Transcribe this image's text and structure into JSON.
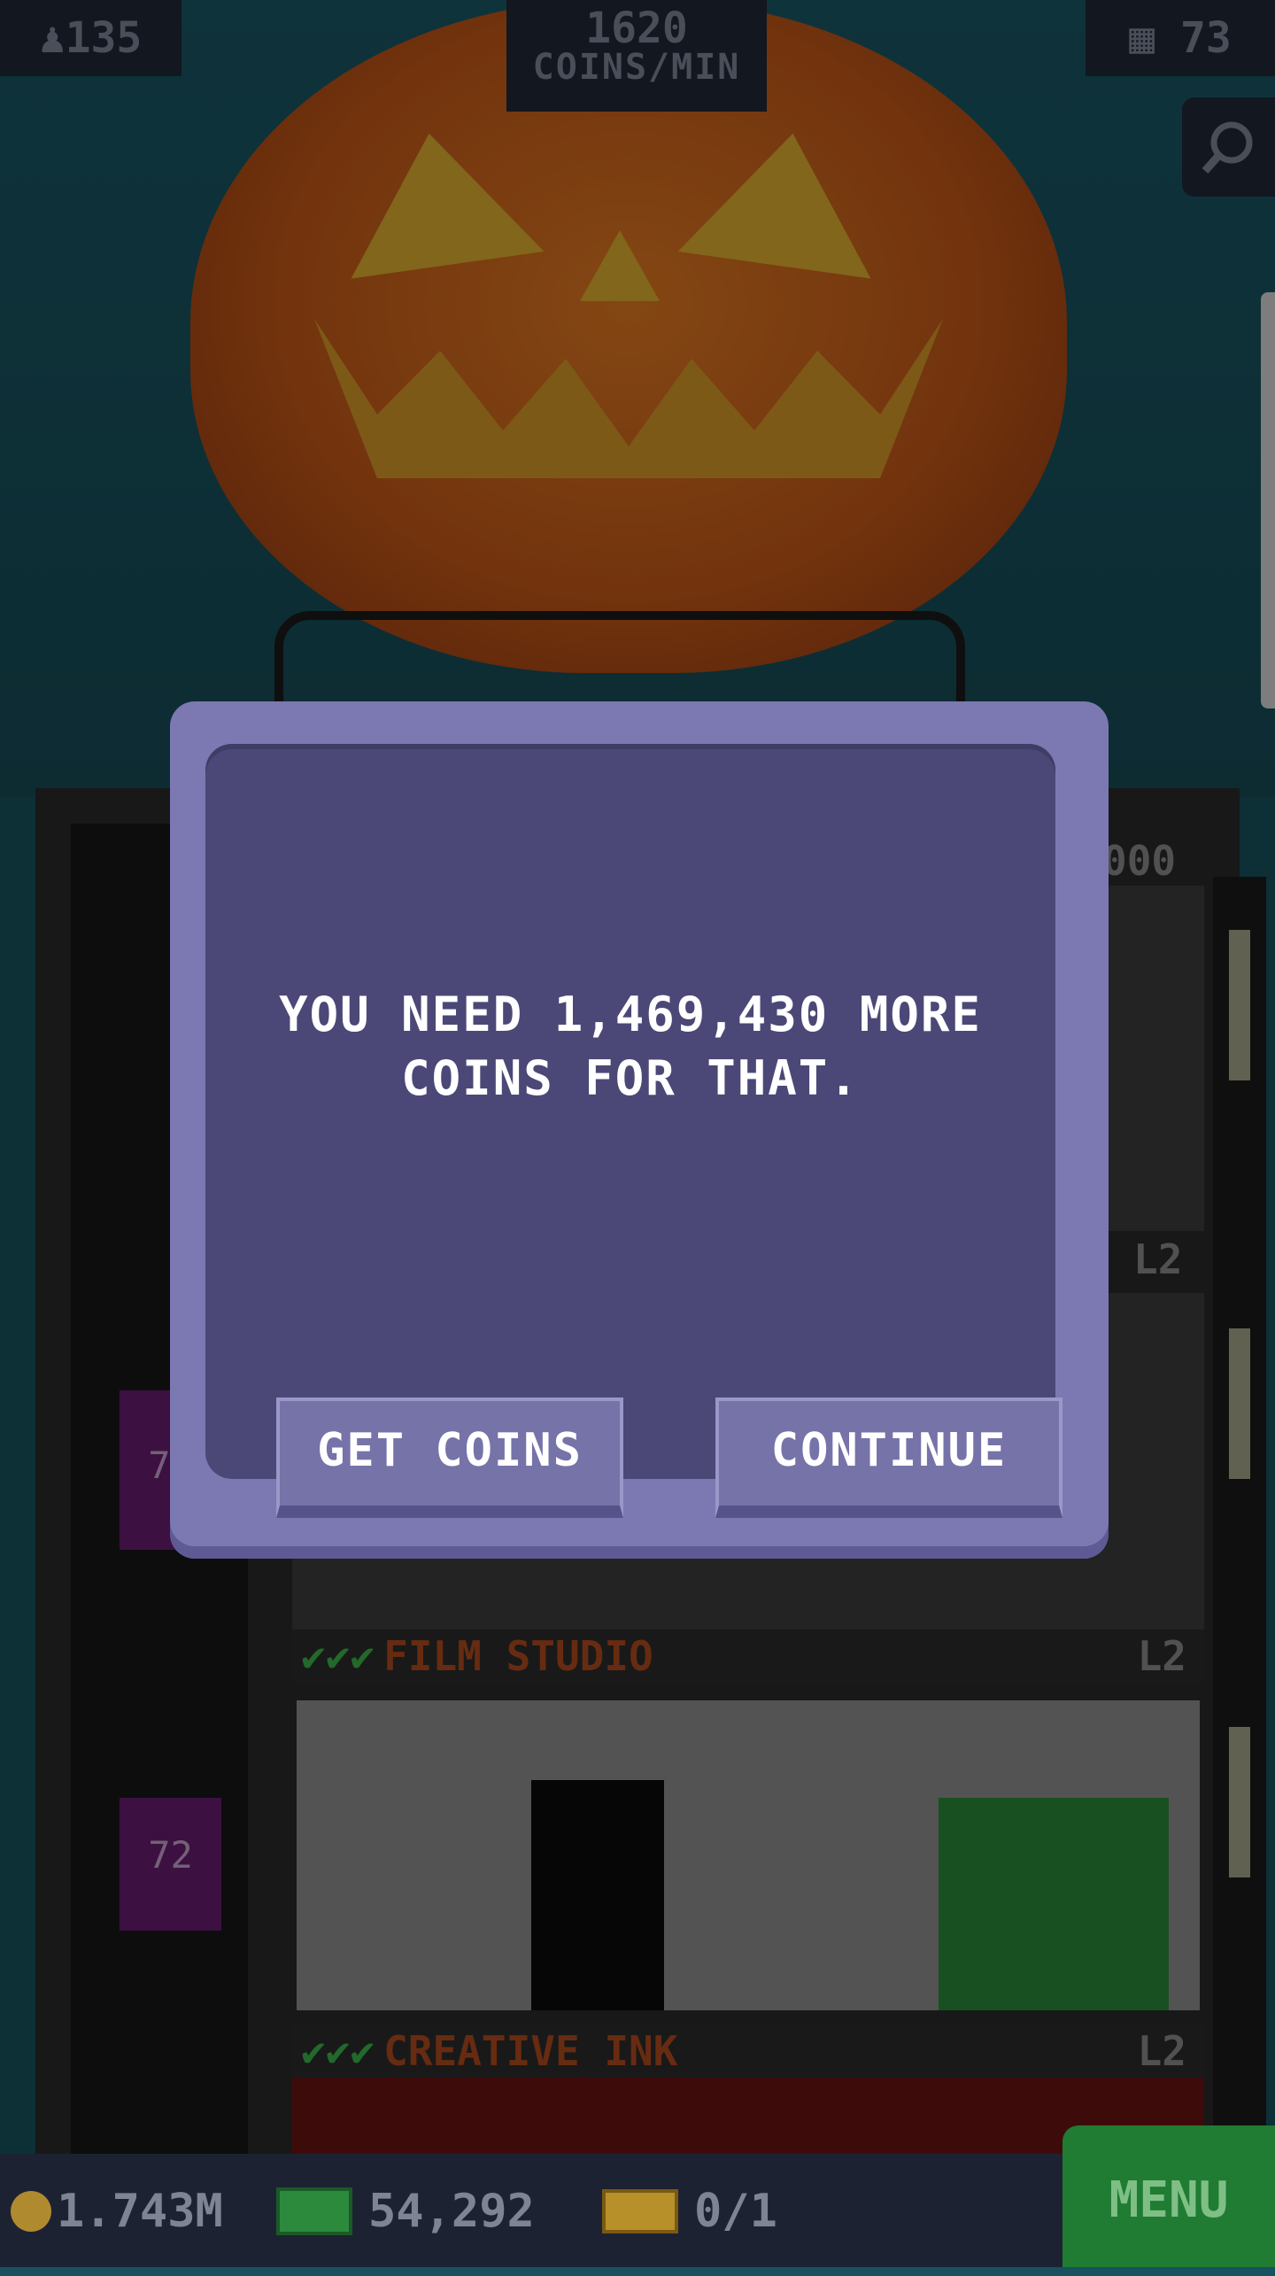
{
  "hud": {
    "population": "135",
    "coins_per_min_value": "1620",
    "coins_per_min_unit": "COINS/MIN",
    "floors": "73",
    "icons": {
      "population": "person-icon",
      "floors": "building-icon",
      "search": "magnifier-icon"
    }
  },
  "tower": {
    "elevator_labels": [
      "73",
      "72"
    ],
    "partial_value": "000",
    "floors": [
      {
        "name": "FILM STUDIO",
        "level": "L2"
      },
      {
        "name": "CREATIVE INK",
        "level": "L2"
      }
    ],
    "upper_level": "L2"
  },
  "dialog": {
    "message": "YOU NEED 1,469,430 MORE COINS FOR THAT.",
    "get_coins_label": "GET COINS",
    "continue_label": "CONTINUE"
  },
  "bottom_bar": {
    "coins": "1.743M",
    "bux": "54,292",
    "chests": "0/1",
    "menu_label": "MENU"
  },
  "colors": {
    "dialog_outer": "#7c78b2",
    "dialog_inner": "#4b4877",
    "button": "#7673a9",
    "menu_green": "#1f7c32",
    "floor_label_orange": "#b14a1e",
    "checkmark_green": "#3cb54a"
  }
}
